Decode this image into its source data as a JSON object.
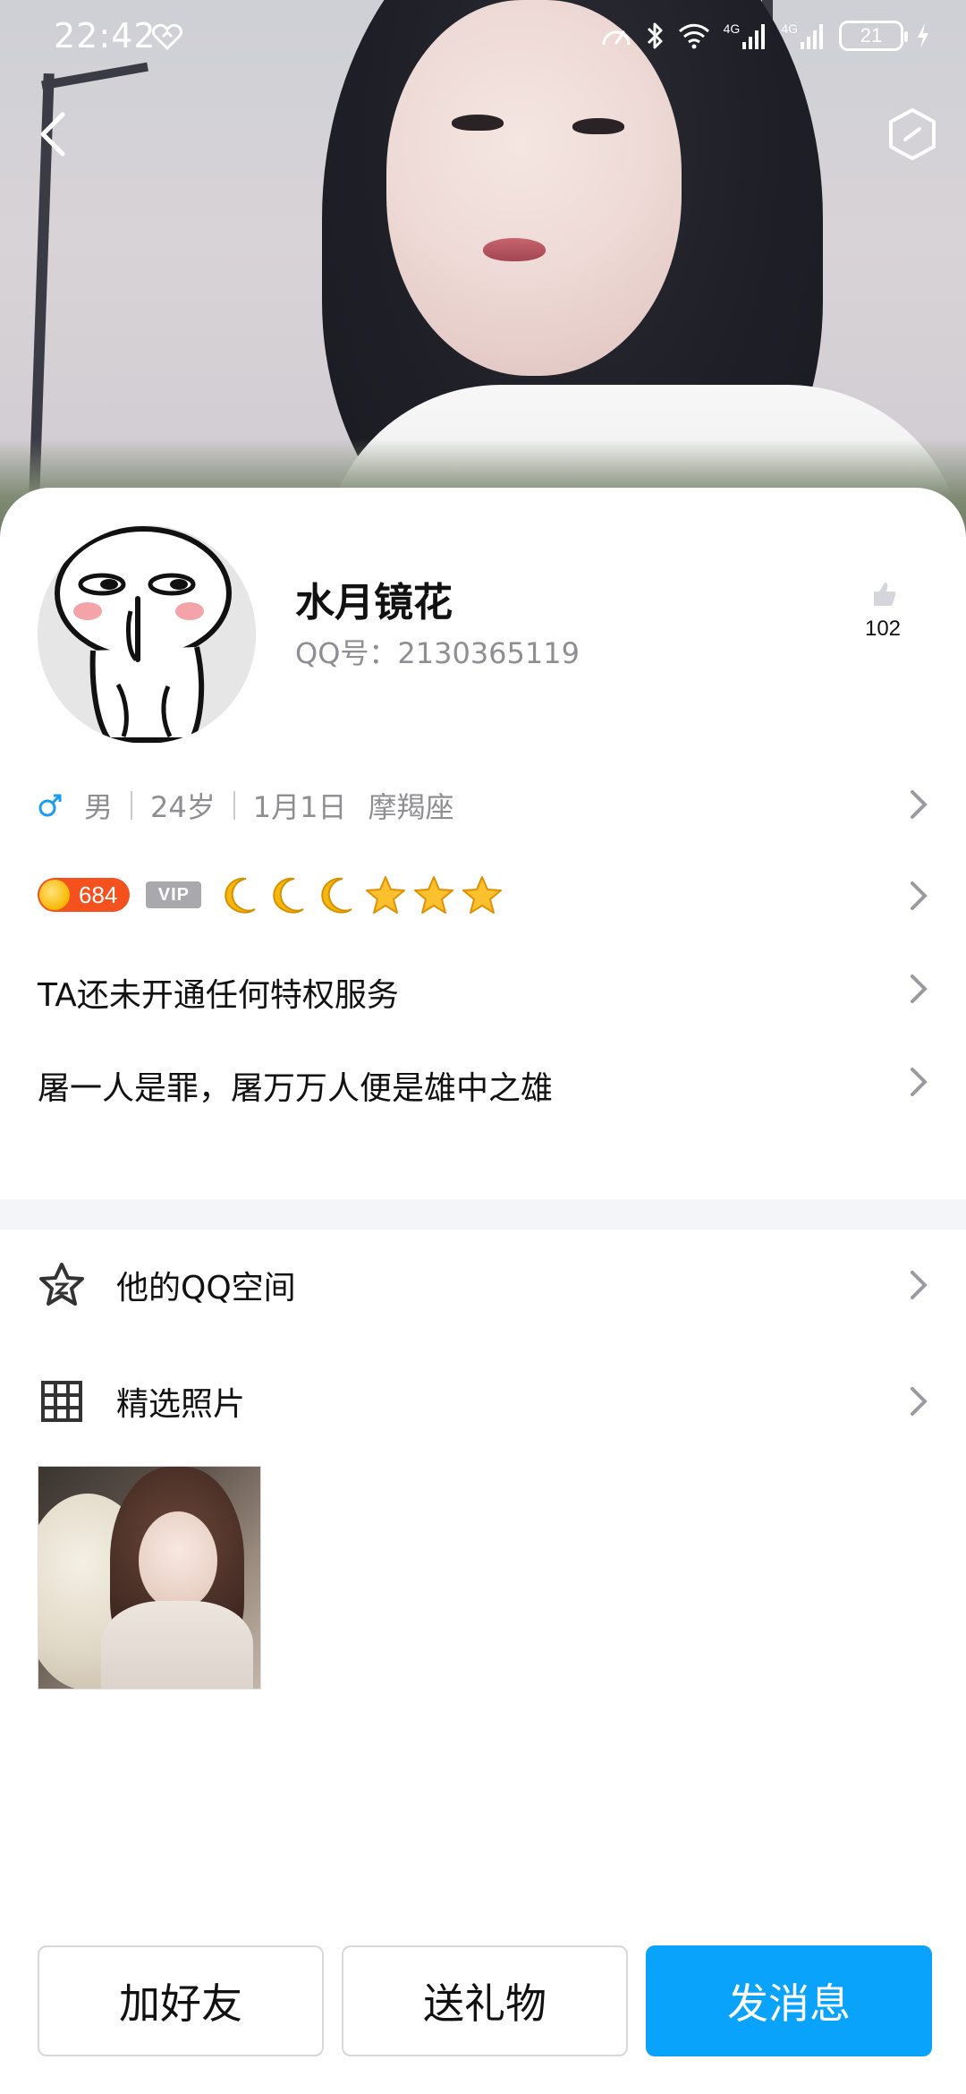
{
  "status_bar": {
    "time": "22:42",
    "network_label_1": "4G",
    "network_label_2": "4G",
    "battery": "21"
  },
  "header": {
    "back_icon": "chevron-left-icon",
    "more_icon": "hexagon-icon"
  },
  "profile": {
    "nickname": "水月镜花",
    "qq_number": "QQ号：2130365119",
    "likes": "102",
    "gender_icon": "male-icon",
    "gender": "男",
    "age": "24岁",
    "birthday": "1月1日",
    "zodiac": "摩羯座",
    "coin_level": "684",
    "vip_label": "VIP",
    "level_icons": [
      "moon-icon",
      "moon-icon",
      "moon-icon",
      "star-icon",
      "star-icon",
      "star-icon"
    ],
    "privilege_text": "TA还未开通任何特权服务",
    "signature": "屠一人是罪，屠万万人便是雄中之雄"
  },
  "list": {
    "qzone_label": "他的QQ空间",
    "photos_label": "精选照片"
  },
  "actions": {
    "add_friend": "加好友",
    "send_gift": "送礼物",
    "send_message": "发消息"
  },
  "colors": {
    "primary_blue": "#0aa3fb",
    "coin_orange": "#f4511e",
    "text_gray": "#8e8e93"
  }
}
